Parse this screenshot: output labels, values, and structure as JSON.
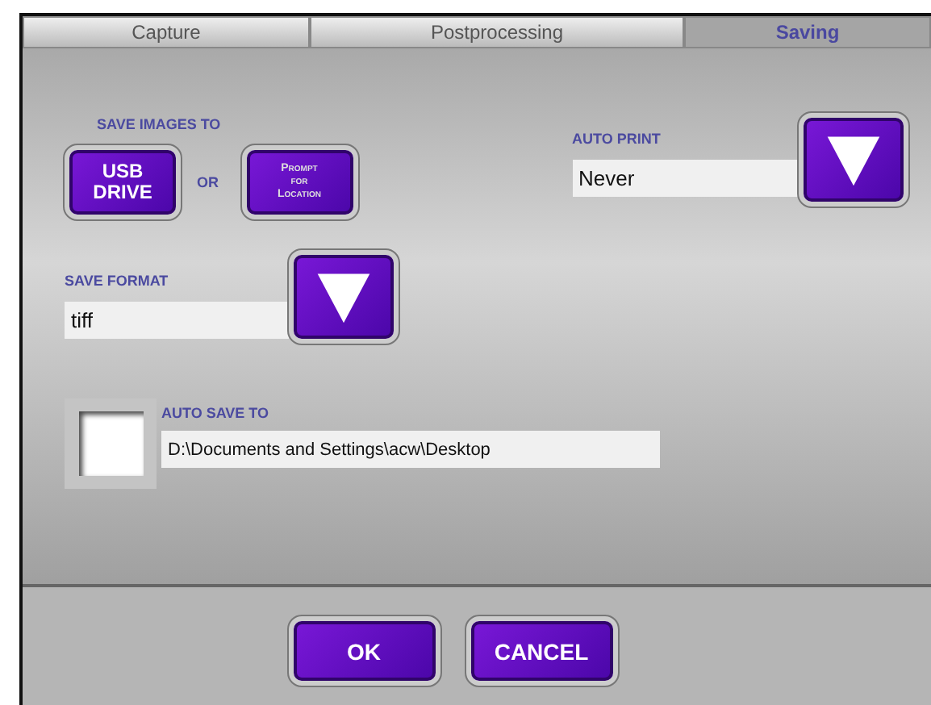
{
  "tabs": [
    {
      "label": "Capture",
      "selected": false
    },
    {
      "label": "Postprocessing",
      "selected": false
    },
    {
      "label": "Saving",
      "selected": true
    }
  ],
  "save_images_to": {
    "label": "SAVE IMAGES TO",
    "usb_button": [
      "USB",
      "DRIVE"
    ],
    "or": "OR",
    "prompt_button": [
      "Prompt",
      "for",
      "Location"
    ]
  },
  "auto_print": {
    "label": "AUTO PRINT",
    "value": "Never"
  },
  "save_format": {
    "label": "SAVE FORMAT",
    "value": "tiff"
  },
  "auto_save": {
    "label": "AUTO SAVE TO",
    "checked": false,
    "value": "D:\\Documents and Settings\\acw\\Desktop"
  },
  "buttons": [
    "OK",
    "CANCEL"
  ]
}
